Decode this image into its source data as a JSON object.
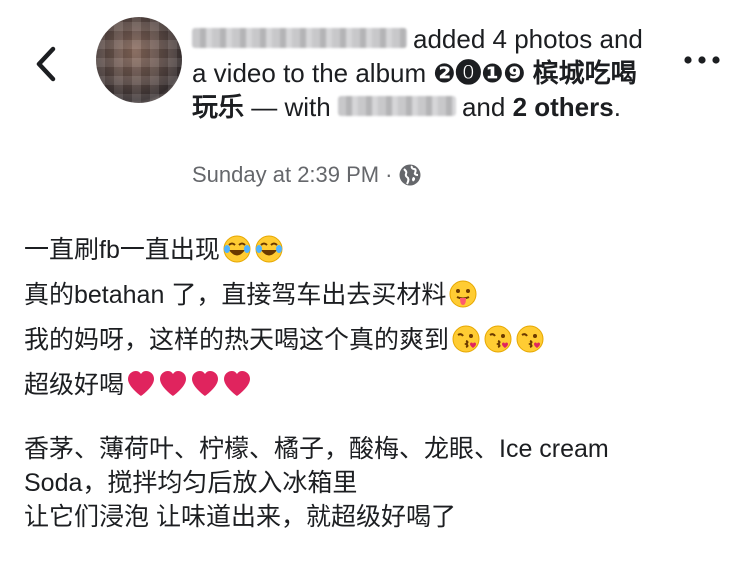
{
  "post": {
    "author_blurred": "",
    "action_text": "added 4 photos and a video to the album",
    "album_name": "❷⓿❶❾ 槟城吃喝玩乐",
    "with_text": "— with",
    "and_text": "and",
    "others_text": "2 others",
    "period": ".",
    "timestamp": "Sunday at 2:39 PM",
    "separator": "·",
    "privacy_icon": "globe-icon"
  },
  "body": {
    "lines": [
      {
        "text": "一直刷fb一直出现",
        "emojis": [
          "tears-of-joy",
          "tears-of-joy"
        ]
      },
      {
        "text": "真的betahan 了，直接驾车出去买材料",
        "emojis": [
          "tongue-out"
        ]
      },
      {
        "text": "我的妈呀，这样的热天喝这个真的爽到",
        "emojis": [
          "kiss",
          "kiss",
          "kiss"
        ]
      },
      {
        "text": "超级好喝",
        "emojis": [
          "heart",
          "heart",
          "heart",
          "heart"
        ]
      }
    ],
    "para2": [
      "香茅、薄荷叶、柠檬、橘子，酸梅、龙眼、Ice cream",
      "Soda，搅拌均匀后放入冰箱里",
      "让它们浸泡  让味道出来，就超级好喝了"
    ]
  },
  "icons": {
    "back": "chevron-left-icon",
    "more": "more-horizontal-icon"
  },
  "colors": {
    "text": "#1c1e21",
    "secondary": "#65676b",
    "heart": "#e0245e"
  }
}
